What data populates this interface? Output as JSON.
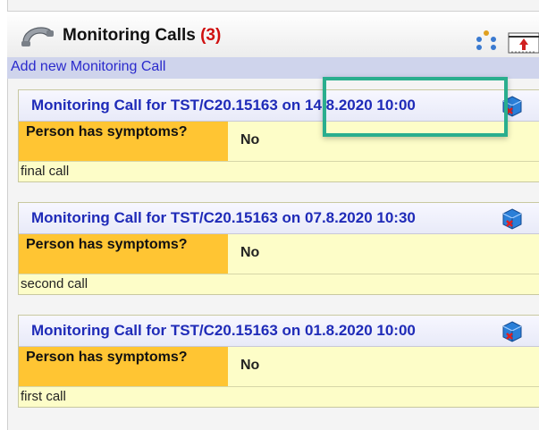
{
  "header": {
    "title": "Monitoring Calls",
    "count": "(3)"
  },
  "add_link": "Add new Monitoring Call",
  "calls": [
    {
      "title": "Monitoring Call for TST/C20.15163 on 14.8.2020 10:00",
      "label": "Person has symptoms?",
      "value": "No",
      "note": "final call"
    },
    {
      "title": "Monitoring Call for TST/C20.15163 on 07.8.2020 10:30",
      "label": "Person has symptoms?",
      "value": "No",
      "note": "second call"
    },
    {
      "title": "Monitoring Call for TST/C20.15163 on 01.8.2020 10:00",
      "label": "Person has symptoms?",
      "value": "No",
      "note": "first call"
    }
  ],
  "colors": {
    "accent_link": "#2a2acc",
    "card_title": "#1f2bb8",
    "label_bg": "#ffc533",
    "card_bg": "#fdfdc8",
    "highlight": "#2aae8e",
    "count": "#d01010"
  },
  "icons": {
    "header": "phone-icon",
    "options": "dots-icon",
    "export": "export-icon",
    "card_action": "cube-delete-icon"
  }
}
